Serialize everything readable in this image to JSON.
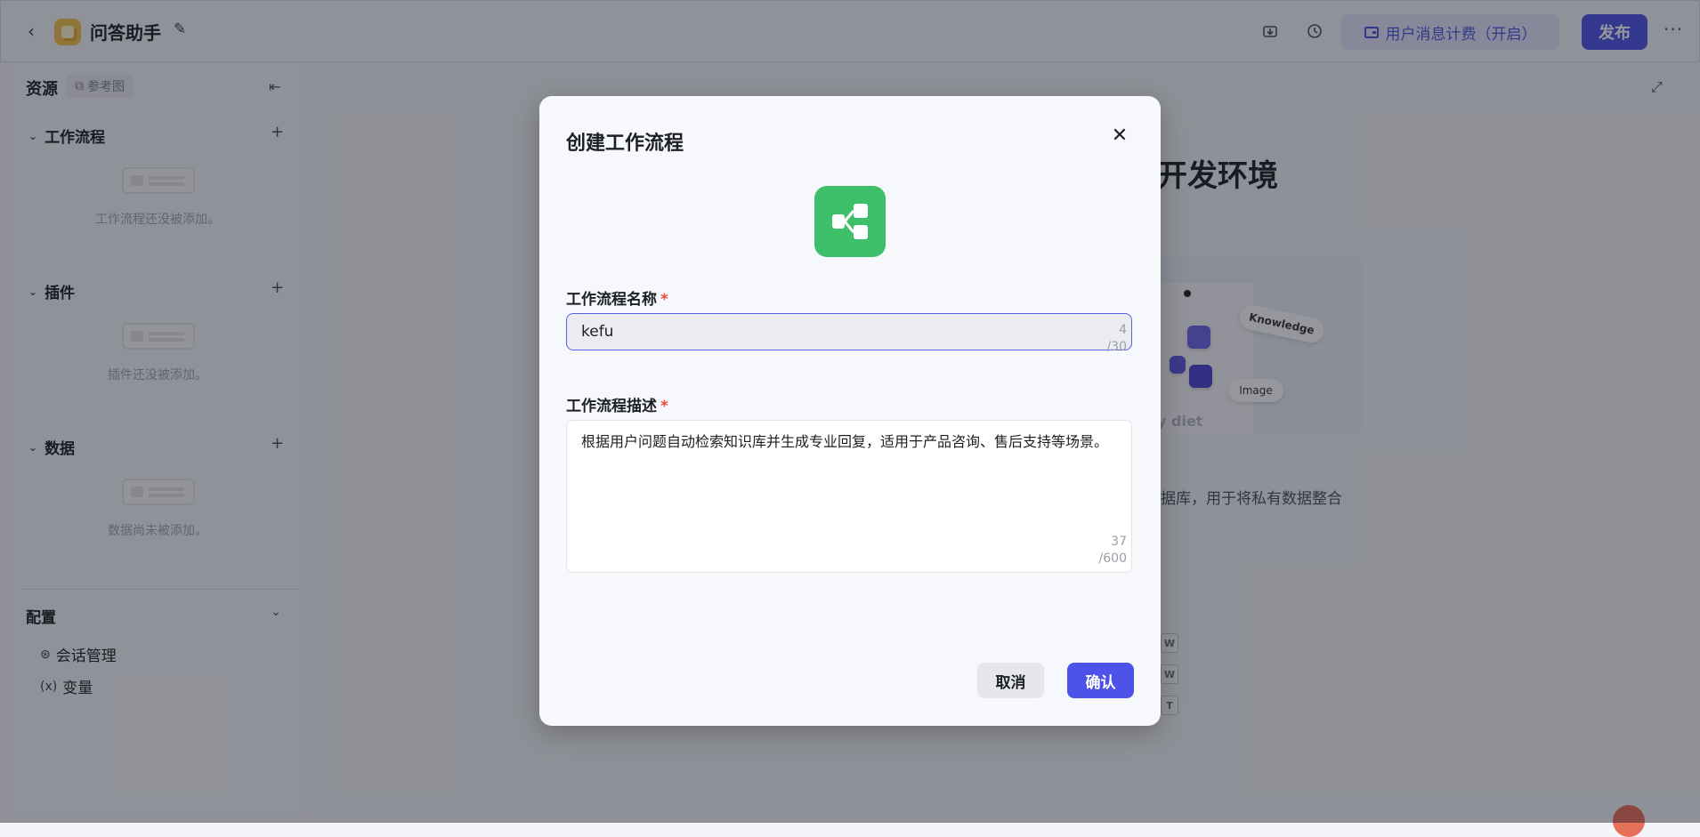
{
  "header": {
    "app_title": "问答助手",
    "billing_label": "用户消息计费（开启）",
    "publish_label": "发布",
    "more_label": "···"
  },
  "sidebar": {
    "title": "资源",
    "ref_tag": "参考图",
    "sections": [
      {
        "title": "工作流程",
        "empty_text": "工作流程还没被添加。"
      },
      {
        "title": "插件",
        "empty_text": "插件还没被添加。"
      },
      {
        "title": "数据",
        "empty_text": "数据尚未被添加。"
      }
    ],
    "config": {
      "title": "配置",
      "items": [
        {
          "label": "会话管理"
        },
        {
          "label": "变量"
        }
      ]
    }
  },
  "main": {
    "heading": "开发环境",
    "illustration_labels": {
      "knowledge": "Knowledge",
      "image": "Image",
      "diet": "y diet"
    },
    "desc_line1": "据库，用于将私有数据整合",
    "shortcut_keys": [
      "W",
      "W",
      "T"
    ]
  },
  "modal": {
    "title": "创建工作流程",
    "close_label": "✕",
    "name_label": "工作流程名称",
    "name_value": "kefu",
    "name_count": "4",
    "name_max": "/30",
    "desc_label": "工作流程描述",
    "desc_value": "根据用户问题自动检索知识库并生成专业回复，适用于产品咨询、售后支持等场景。",
    "desc_count": "37",
    "desc_max": "/600",
    "required_mark": "*",
    "cancel_label": "取消",
    "confirm_label": "确认"
  },
  "colors": {
    "primary": "#4d53e8",
    "workflow_icon": "#3ec06a",
    "app_icon": "#f3c24b",
    "required": "#f0483b"
  },
  "icons": [
    "back-arrow-icon",
    "app-logo-icon",
    "edit-icon",
    "download-icon",
    "history-icon",
    "wallet-icon",
    "more-icon",
    "copy-icon",
    "collapse-sidebar-icon",
    "chevron-down-icon",
    "plus-icon",
    "session-icon",
    "variable-icon",
    "expand-icon",
    "close-icon",
    "workflow-icon"
  ]
}
